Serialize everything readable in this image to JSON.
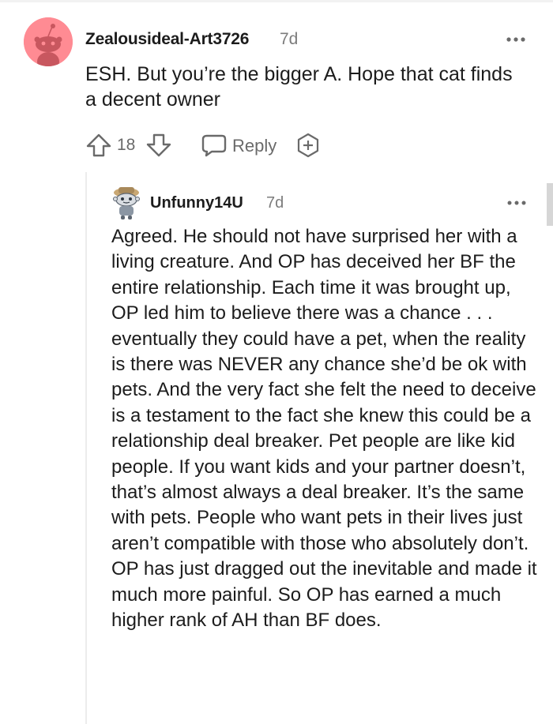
{
  "comment": {
    "author": "Zealousideal-Art3726",
    "time": "7d",
    "body": "ESH. But you’re the bigger A. Hope that cat finds a decent owner",
    "score": "18",
    "reply_label": "Reply",
    "icons": {
      "avatar": "reddit-snoo-avatar",
      "upvote": "arrow-up-icon",
      "downvote": "arrow-down-icon",
      "reply": "speech-bubble-icon",
      "award": "award-plus-icon",
      "more": "more-dots-icon"
    },
    "avatar_color": "#ff8b93"
  },
  "reply": {
    "author": "Unfunny14U",
    "time": "7d",
    "body": "Agreed. He should not have surprised her with a living creature. And OP has deceived her BF the entire relationship. Each time it was brought up, OP led him to believe there was a chance . . . eventually they could have a pet, when the reality is there was NEVER any chance she’d be ok with pets. And the very fact she felt the need to deceive is a testament to the fact she knew this could be a relationship deal breaker. Pet people are like kid people. If you want kids and your partner doesn’t, that’s almost always a deal breaker. It’s the same with pets. People who want pets in their lives just aren’t compatible with those who absolutely don’t. OP has just dragged out the inevitable and made it much more painful. So OP has earned a much higher rank of AH than BF does.",
    "icons": {
      "avatar": "snoo-avatar-with-hat",
      "more": "more-dots-icon"
    }
  }
}
